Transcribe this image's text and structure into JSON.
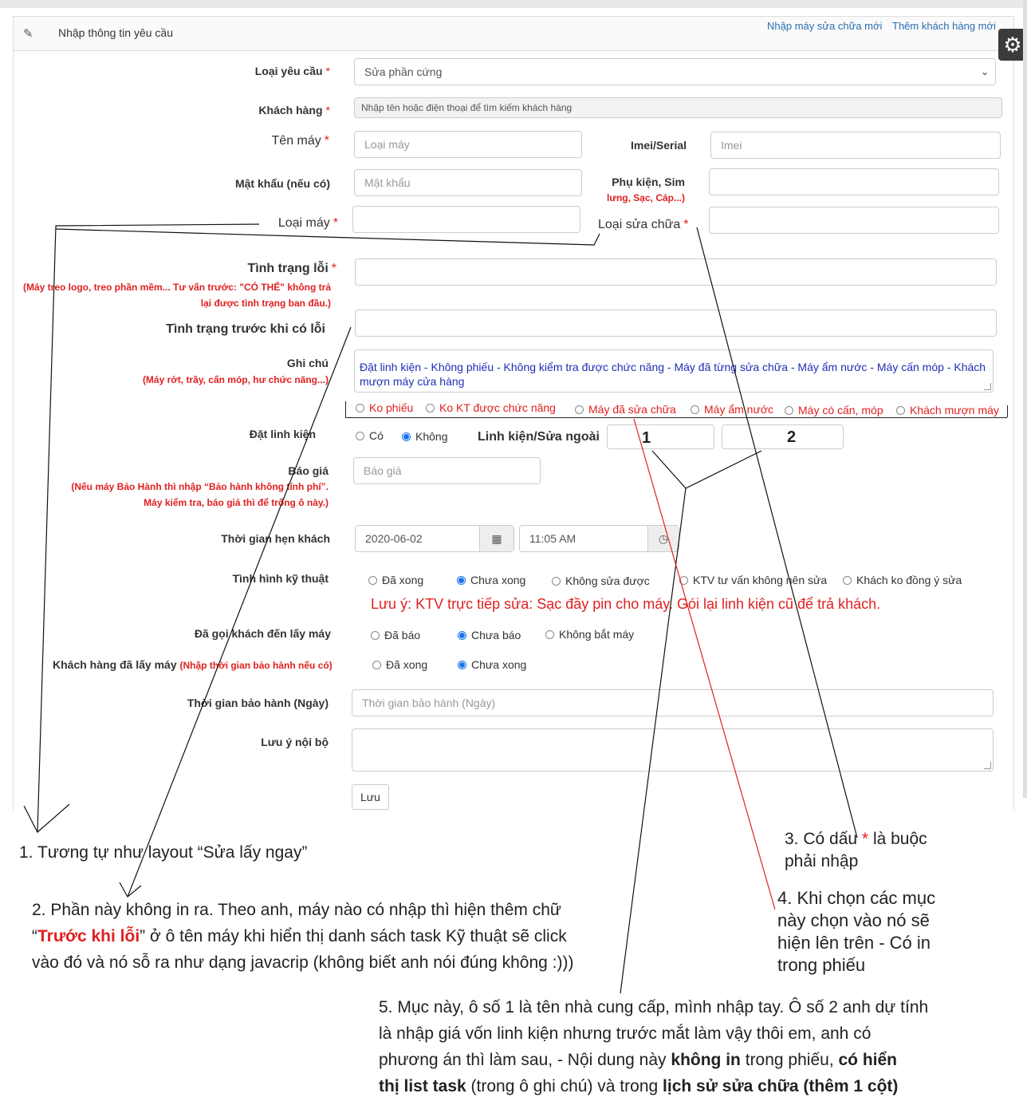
{
  "header": {
    "title": "Nhập thông tin yêu cầu",
    "link_repair": "Nhập máy sửa chữa mới",
    "link_customer": "Thêm khách hàng mới"
  },
  "form": {
    "request_type": {
      "label": "Loại yêu cầu",
      "value": "Sửa phần cứng"
    },
    "customer": {
      "label": "Khách hàng",
      "placeholder": "Nhập tên hoặc điện thoại để tìm kiếm khách hàng"
    },
    "device_name": {
      "label": "Tên máy",
      "placeholder": "Loại máy"
    },
    "imei": {
      "label": "Imei/Serial",
      "placeholder": "Imei"
    },
    "password": {
      "label": "Mật khẩu (nếu có)",
      "placeholder": "Mật khẩu"
    },
    "accessories": {
      "label": "Phụ kiện, Sim",
      "hint": "lưng, Sạc, Cáp...)"
    },
    "device_type": {
      "label": "Loại máy"
    },
    "repair_type": {
      "label": "Loại  sửa chữa"
    },
    "error_state": {
      "label": "Tình trạng lỗi",
      "hint1": "(Máy treo logo, treo phần mềm... Tư vấn trước: \"CÓ THỂ\" không trả",
      "hint2": "lại được tình trạng ban đầu.)"
    },
    "pre_error_state": {
      "label": "Tình trạng trước khi có lỗi"
    },
    "notes": {
      "label": "Ghi chú",
      "hint": "(Máy rớt, trầy, cấn móp, hư chức năng...)",
      "value": "Đặt linh kiện - Không phiếu - Không kiểm tra được chức năng - Máy đã từng sửa chữa - Máy ẩm nước - Máy cấn móp - Khách mượn máy cửa hàng",
      "options": [
        "Ko phiếu",
        "Ko KT được chức năng",
        "Máy đã sửa chữa",
        "Máy ẩm nước",
        "Máy có cấn, móp",
        "Khách mượn máy"
      ]
    },
    "parts_order": {
      "label": "Đặt linh kiện",
      "options": [
        "Có",
        "Không"
      ],
      "selected": "Không",
      "external_label": "Linh kiện/Sửa ngoài",
      "box1": "1",
      "box2": "2"
    },
    "quote": {
      "label": "Báo giá",
      "placeholder": "Báo giá",
      "hint1": "(Nếu máy Bảo Hành thì nhập “Bảo hành không tính phí”.",
      "hint2": "Máy kiểm tra, báo giá thì để trống ô này.)"
    },
    "appointment": {
      "label": "Thời gian hẹn khách",
      "date": "2020-06-02",
      "time": "11:05 AM"
    },
    "tech_status": {
      "label": "Tình hình kỹ thuật",
      "options": [
        "Đã xong",
        "Chưa xong",
        "Không sửa được",
        "KTV tư vấn không nên sửa",
        "Khách ko đồng ý sửa"
      ],
      "selected": "Chưa xong",
      "notice": "Lưu ý: KTV trực tiếp sửa: Sạc đầy pin cho máy. Gói lại linh kiện cũ để trả khách."
    },
    "called_customer": {
      "label": "Đã gọi khách đến lấy máy",
      "options": [
        "Đã báo",
        "Chưa báo",
        "Không bắt máy"
      ],
      "selected": "Chưa báo"
    },
    "picked_up": {
      "label": "Khách hàng đã lấy máy",
      "hint": "(Nhập thời gian bảo hành nếu có)",
      "options": [
        "Đã xong",
        "Chưa xong"
      ],
      "selected": "Chưa xong"
    },
    "warranty": {
      "label": "Thời gian bảo hành (Ngày)",
      "placeholder": "Thời gian bảo hành (Ngày)"
    },
    "internal_note": {
      "label": "Lưu ý nội bộ"
    },
    "save_label": "Lưu"
  },
  "annotations": {
    "a1": "1. Tương tự như layout “Sửa lấy ngay”",
    "a2_part1": "2. Phần này không in ra. Theo anh, máy nào có nhập thì hiện thêm chữ",
    "a2_quote_open": "“",
    "a2_red": "Trước khi lỗi",
    "a2_part2": "” ở ô tên máy khi hiển thị danh sách task Kỹ thuật sẽ click",
    "a2_part3": "vào đó và nó sỗ ra như dạng javacrip (không biết anh nói đúng không :)))",
    "a3_part1": "3. Có dấu",
    "a3_star": "*",
    "a3_part2": "là buộc",
    "a3_part3": "phải nhập",
    "a4_l1": "4. Khi chọn các mục",
    "a4_l2": "này chọn vào nó sẽ",
    "a4_l3": "hiện lên trên - Có in",
    "a4_l4": "trong phiếu",
    "a5_l1": "5. Mục này, ô số 1 là tên nhà cung cấp, mình nhập tay. Ô số 2 anh dự tính",
    "a5_l2": "là nhập giá vốn linh kiện nhưng trước mắt làm vậy thôi em, anh có",
    "a5_l3a": "phương án thì làm sau, - Nội dung này",
    "a5_l3b": "không in",
    "a5_l3c": "trong phiếu,",
    "a5_l3d": "có hiển",
    "a5_l4a": "thị list task",
    "a5_l4b": "(trong ô ghi chú) và trong",
    "a5_l4c": "lịch sử sửa chữa (thêm 1 cột)"
  }
}
